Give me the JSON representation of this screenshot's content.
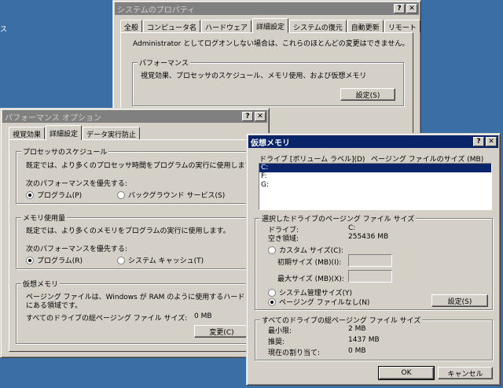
{
  "desktop": {
    "edge_text": "ス"
  },
  "system_properties": {
    "title": "システムのプロパティ",
    "tabs": [
      "全般",
      "コンピュータ名",
      "ハードウェア",
      "詳細設定",
      "システムの復元",
      "自動更新",
      "リモート"
    ],
    "admin_note": "Administrator としてログオンしない場合は、これらのほとんどの変更はできません。",
    "performance_group": "パフォーマンス",
    "performance_desc": "視覚効果、プロセッサのスケジュール、メモリ使用、および仮想メモリ",
    "settings_button": "設定(S)"
  },
  "performance_options": {
    "title": "パフォーマンス オプション",
    "tabs": [
      "視覚効果",
      "詳細設定",
      "データ実行防止"
    ],
    "processor_group": "プロセッサのスケジュール",
    "processor_desc": "既定では、より多くのプロセッサ時間をプログラムの実行に使用します。",
    "processor_adjust": "次のパフォーマンスを優先する:",
    "processor_opt1": "プログラム(P)",
    "processor_opt2": "バックグラウンド サービス(S)",
    "memory_group": "メモリ使用量",
    "memory_desc": "既定では、より多くのメモリをプログラムの実行に使用します。",
    "memory_adjust": "次のパフォーマンスを優先する:",
    "memory_opt1": "プログラム(R)",
    "memory_opt2": "システム キャッシュ(T)",
    "vm_group": "仮想メモリ",
    "vm_desc1": "ページング ファイルは、Windows が RAM のように使用するハード ディスク",
    "vm_desc2": "にある領域です。",
    "vm_total_label": "すべてのドライブの総ページング ファイル サイズ:",
    "vm_total_value": "0 MB",
    "change_button": "変更(C)"
  },
  "virtual_memory": {
    "title": "仮想メモリ",
    "col_drive": "ドライブ [ボリューム ラベル](D)",
    "col_size": "ページング ファイルのサイズ (MB)",
    "drives": [
      "C:",
      "F:",
      "G:"
    ],
    "selected_group": "選択したドライブのページング ファイル サイズ",
    "drive_label": "ドライブ:",
    "drive_value": "C:",
    "free_label": "空き領域:",
    "free_value": "255436 MB",
    "custom_size": "カスタム サイズ(C):",
    "initial_size": "初期サイズ (MB)(I):",
    "max_size": "最大サイズ (MB)(X):",
    "system_managed": "システム管理サイズ(Y)",
    "no_paging": "ページング ファイルなし(N)",
    "set_button": "設定(S)",
    "total_group": "すべてのドライブの総ページング ファイル サイズ",
    "min_label": "最小限:",
    "min_value": "2 MB",
    "rec_label": "推奨:",
    "rec_value": "1437 MB",
    "cur_label": "現在の割り当て:",
    "cur_value": "0 MB",
    "ok_button": "OK",
    "cancel_button": "キャンセル"
  }
}
